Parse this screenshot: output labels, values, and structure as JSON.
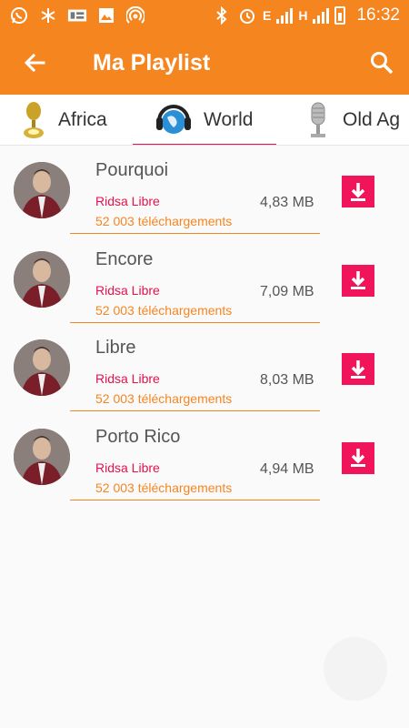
{
  "status_bar": {
    "network_e": "E",
    "network_h": "H",
    "time": "16:32"
  },
  "appbar": {
    "title": "Ma Playlist",
    "back_icon": "arrow-left-icon",
    "search_icon": "search-icon"
  },
  "tabs": [
    {
      "label": "Africa",
      "icon": "gold-microphone-icon",
      "selected": false
    },
    {
      "label": "World",
      "icon": "globe-headphones-icon",
      "selected": true
    },
    {
      "label": "Old Ag",
      "icon": "vintage-microphone-icon",
      "selected": false
    }
  ],
  "songs": [
    {
      "title": "Pourquoi",
      "artist": "Ridsa Libre",
      "downloads": "52 003 téléchargements",
      "size": "4,83 MB"
    },
    {
      "title": "Encore",
      "artist": "Ridsa Libre",
      "downloads": "52 003 téléchargements",
      "size": "7,09 MB"
    },
    {
      "title": "Libre",
      "artist": "Ridsa Libre",
      "downloads": "52 003 téléchargements",
      "size": "8,03 MB"
    },
    {
      "title": "Porto Rico",
      "artist": "Ridsa Libre",
      "downloads": "52 003 téléchargements",
      "size": "4,94 MB"
    }
  ],
  "colors": {
    "primary": "#f5851f",
    "accent": "#e6114f",
    "download_button": "#f0145a"
  }
}
